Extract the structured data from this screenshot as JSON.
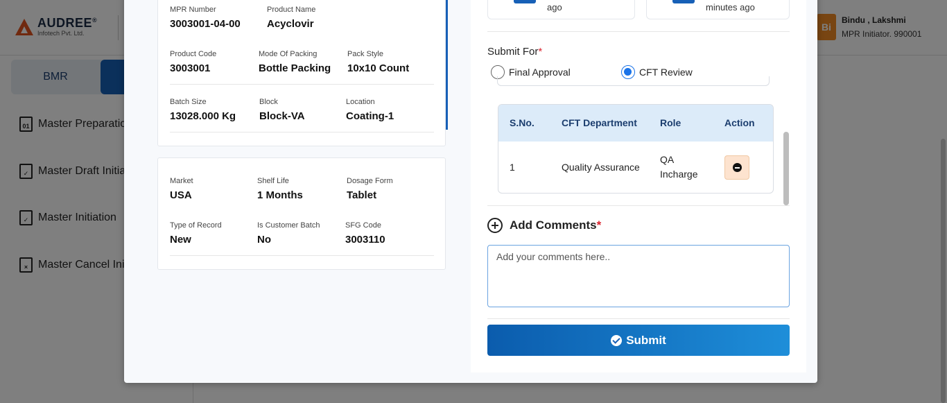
{
  "background": {
    "brand": {
      "name": "AUDREE",
      "registered": "®",
      "sub": "Infotech Pvt. Ltd."
    },
    "user": {
      "initials": "Bi",
      "name": "Bindu , Lakshmi",
      "role": "MPR Initiator. 990001"
    },
    "tabs": {
      "bmr": "BMR"
    },
    "sidebar": [
      {
        "label": "Master Preparation",
        "icon": "01"
      },
      {
        "label": "Master Draft Initiation",
        "icon": ""
      },
      {
        "label": "Master Initiation",
        "icon": ""
      },
      {
        "label": "Master Cancel Initiation",
        "icon": ""
      }
    ]
  },
  "product_card": {
    "mpr_number": {
      "label": "MPR Number",
      "value": "3003001-04-00"
    },
    "product_name": {
      "label": "Product Name",
      "value": "Acyclovir"
    },
    "product_code": {
      "label": "Product Code",
      "value": "3003001"
    },
    "mode_of_packing": {
      "label": "Mode Of Packing",
      "value": "Bottle Packing"
    },
    "pack_style": {
      "label": "Pack Style",
      "value": "10x10 Count"
    },
    "batch_size": {
      "label": "Batch Size",
      "value": "13028.000 Kg"
    },
    "block": {
      "label": "Block",
      "value": "Block-VA"
    },
    "location": {
      "label": "Location",
      "value": "Coating-1"
    }
  },
  "market_card": {
    "market": {
      "label": "Market",
      "value": "USA"
    },
    "shelf_life": {
      "label": "Shelf Life",
      "value": "1 Months"
    },
    "dosage_form": {
      "label": "Dosage Form",
      "value": "Tablet"
    },
    "type_of_record": {
      "label": "Type of Record",
      "value": "New"
    },
    "customer_batch": {
      "label": "Is Customer Batch",
      "value": "No"
    },
    "sfg_code": {
      "label": "SFG Code",
      "value": "3003110"
    }
  },
  "timeline": {
    "card1_text": "ago",
    "card2_text": "minutes ago"
  },
  "submit_for": {
    "label": "Submit For",
    "required_mark": "*",
    "options": [
      {
        "label": "Final Approval",
        "checked": false
      },
      {
        "label": "CFT Review",
        "checked": true
      }
    ]
  },
  "cft_table": {
    "headers": [
      "S.No.",
      "CFT Department",
      "Role",
      "Action"
    ],
    "rows": [
      {
        "sno": "1",
        "department": "Quality Assurance",
        "role_line1": "QA",
        "role_line2": "Incharge"
      }
    ]
  },
  "comments": {
    "title": "Add Comments",
    "required_mark": "*",
    "placeholder": "Add your comments here..",
    "value": ""
  },
  "submit_button": {
    "label": "Submit"
  },
  "colors": {
    "primary": "#1760b7",
    "required": "#d9232e",
    "table_header": "#dcebf9",
    "remove_button": "#fde3cf",
    "avatar": "#f08a24",
    "logo": "#e0531f"
  }
}
